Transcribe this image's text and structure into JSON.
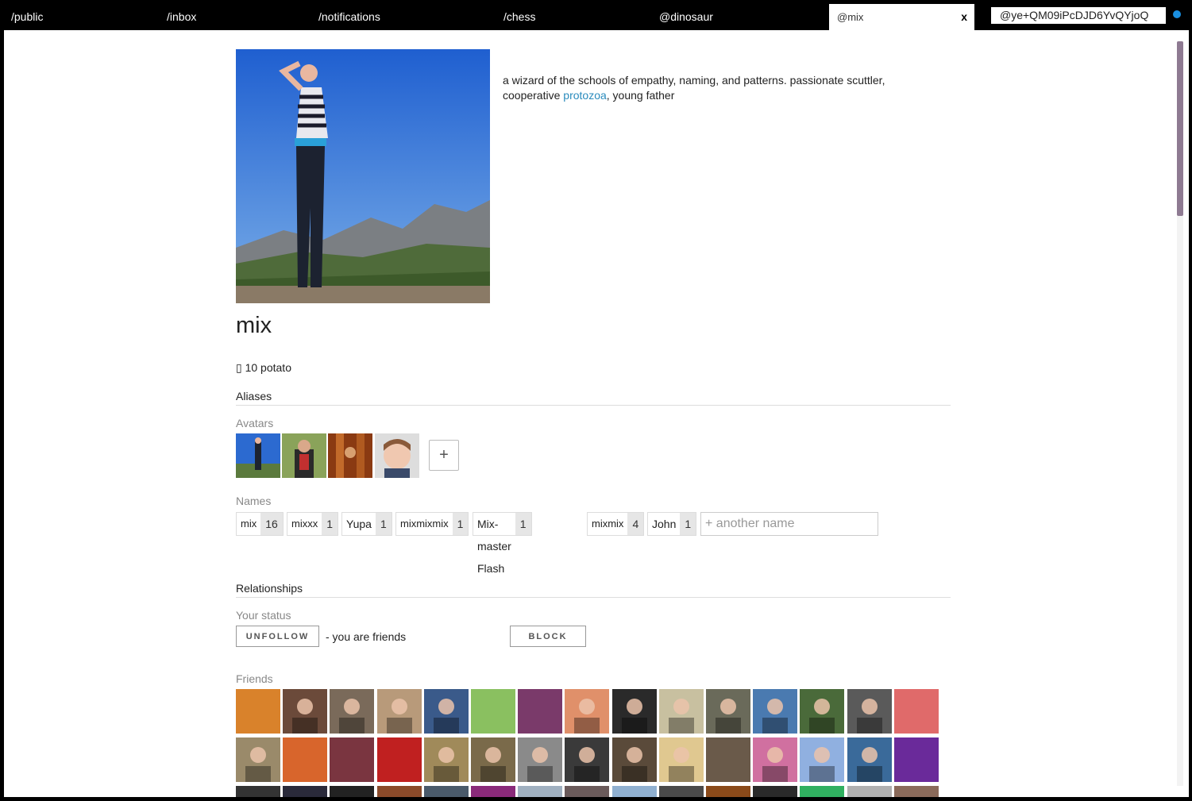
{
  "tabs": [
    {
      "label": "/public"
    },
    {
      "label": "/inbox"
    },
    {
      "label": "/notifications"
    },
    {
      "label": "/chess"
    },
    {
      "label": "@dinosaur"
    },
    {
      "label": "@mix",
      "active": true,
      "close": "x"
    }
  ],
  "search": {
    "value": "@ye+QM09iPcDJD6YvQYjoQ"
  },
  "status_color": "#1a8fe0",
  "profile": {
    "bio_text": "a wizard of the schools of empathy, naming, and patterns. passionate scuttler, cooperative ",
    "bio_link": "protozoa",
    "bio_end": ", young father",
    "name": "mix",
    "potato": "▯ 10 potato"
  },
  "aliases": {
    "heading": "Aliases",
    "avatars_label": "Avatars",
    "add_label": "+",
    "names_label": "Names",
    "names": [
      {
        "name": "mix",
        "count": "16"
      },
      {
        "name": "mixxx",
        "count": "1"
      },
      {
        "name": "Yupa",
        "count": "1"
      },
      {
        "name": "mixmixmix",
        "count": "1"
      },
      {
        "name": "Mix-master Flash",
        "count": "1"
      },
      {
        "name": "mixmix",
        "count": "4"
      },
      {
        "name": "John",
        "count": "1"
      }
    ],
    "another_name_placeholder": "+ another name"
  },
  "relationships": {
    "heading": "Relationships",
    "your_status_label": "Your status",
    "unfollow_label": "UNFOLLOW",
    "status_text": "- you are friends",
    "block_label": "BLOCK",
    "friends_label": "Friends"
  },
  "colors": {
    "link": "#2a8bbd",
    "scroll_thumb": "#8e7a92"
  }
}
